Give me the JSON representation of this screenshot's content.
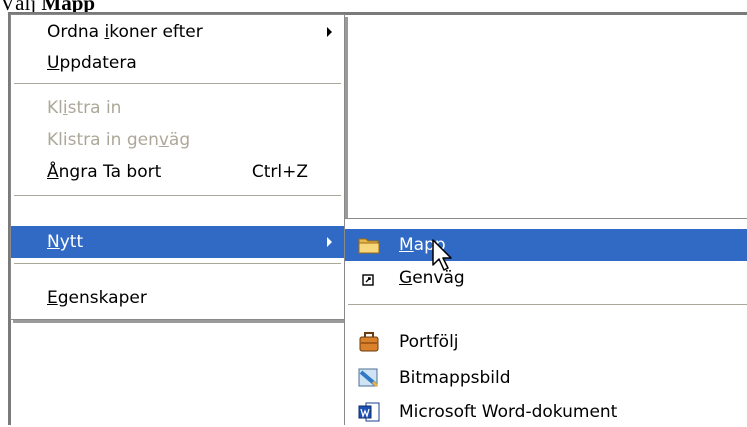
{
  "caption": {
    "prefix": "Välj ",
    "emphasis": "Mapp"
  },
  "context_menu": {
    "arrange_icons": {
      "pre": "Ordna ",
      "key": "i",
      "post": "koner efter"
    },
    "refresh": {
      "pre": "",
      "key": "U",
      "post": "ppdatera"
    },
    "paste": {
      "pre": "Kl",
      "key": "i",
      "post": "stra in"
    },
    "paste_shortcut": {
      "pre": "Klistra in gen",
      "key": "v",
      "post": "äg"
    },
    "undo_delete": {
      "pre": "",
      "key": "Å",
      "post": "ngra Ta bort",
      "shortcut": "Ctrl+Z"
    },
    "new": {
      "pre": "",
      "key": "N",
      "post": "ytt"
    },
    "properties": {
      "pre": "",
      "key": "E",
      "post": "genskaper"
    }
  },
  "new_submenu": {
    "folder": {
      "pre": "",
      "key": "M",
      "post": "app",
      "icon": "folder-icon"
    },
    "shortcut": {
      "pre": "",
      "key": "G",
      "post": "enväg",
      "icon": "shortcut-icon"
    },
    "briefcase": {
      "label": "Portfölj",
      "icon": "briefcase-icon"
    },
    "bitmap": {
      "label": "Bitmappsbild",
      "icon": "bitmap-icon"
    },
    "word": {
      "label": "Microsoft Word-dokument",
      "icon": "word-document-icon"
    }
  },
  "colors": {
    "highlight": "#316ac5",
    "disabled": "#aca899"
  }
}
